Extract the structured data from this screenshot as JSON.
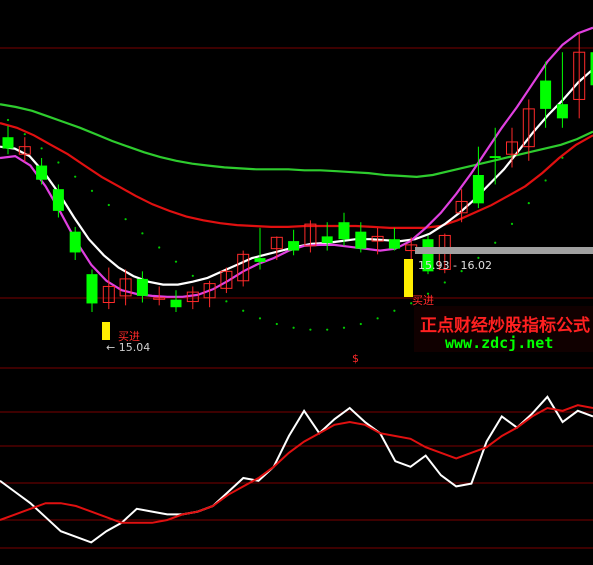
{
  "colors": {
    "background": "#000000",
    "grid": "#7a0000",
    "up_candle": "#ff2a2a",
    "down_candle_fill": "#00ff00",
    "hollow_up_fill": "#00e5ff",
    "signal_bar": "#ffee00",
    "ma_green": "#2ecc2e",
    "ma_red": "#e01010",
    "ma_white": "#ffffff",
    "ma_magenta": "#e040e0",
    "dots": "#00cc00",
    "price_line": "#a0a0a0",
    "watermark_cn": "#ff2020",
    "watermark_url": "#00ff00"
  },
  "labels": {
    "low_marker": "← 15.04",
    "buy_low": "买进",
    "buy_signal": "买进",
    "price_range": "15.93 - 16.02",
    "divider_mark": "$"
  },
  "watermark": {
    "cn": "正点财经炒股指标公式",
    "url": "www.zdcj.net"
  },
  "chart_data": [
    {
      "type": "candlestick",
      "title": "",
      "ylim": [
        14.6,
        18.2
      ],
      "x": [
        1,
        2,
        3,
        4,
        5,
        6,
        7,
        8,
        9,
        10,
        11,
        12,
        13,
        14,
        15,
        16,
        17,
        18,
        19,
        20,
        21,
        22,
        23,
        24,
        25,
        26,
        27,
        28,
        29,
        30,
        31,
        32,
        33,
        34,
        35,
        36,
        37,
        38,
        39,
        40,
        41,
        42,
        43,
        44,
        45,
        46,
        47,
        48,
        49
      ],
      "ohlc": [
        [
          16.8,
          16.92,
          16.62,
          16.68
        ],
        [
          16.62,
          16.8,
          16.54,
          16.7
        ],
        [
          16.5,
          16.58,
          16.3,
          16.35
        ],
        [
          16.25,
          16.3,
          15.95,
          16.02
        ],
        [
          15.8,
          15.85,
          15.5,
          15.58
        ],
        [
          15.35,
          15.4,
          14.95,
          15.04
        ],
        [
          15.05,
          15.42,
          14.98,
          15.22
        ],
        [
          15.12,
          15.4,
          15.02,
          15.3
        ],
        [
          15.3,
          15.38,
          15.05,
          15.12
        ],
        [
          15.1,
          15.22,
          15.02,
          15.1
        ],
        [
          15.08,
          15.18,
          14.95,
          15.0
        ],
        [
          15.06,
          15.22,
          14.98,
          15.16
        ],
        [
          15.1,
          15.28,
          15.0,
          15.25
        ],
        [
          15.2,
          15.42,
          15.15,
          15.38
        ],
        [
          15.28,
          15.6,
          15.22,
          15.56
        ],
        [
          15.52,
          15.84,
          15.4,
          15.48
        ],
        [
          15.62,
          15.75,
          15.5,
          15.74
        ],
        [
          15.7,
          15.82,
          15.55,
          15.6
        ],
        [
          15.65,
          15.92,
          15.58,
          15.88
        ],
        [
          15.75,
          15.9,
          15.6,
          15.68
        ],
        [
          15.9,
          16.0,
          15.65,
          15.72
        ],
        [
          15.8,
          15.9,
          15.58,
          15.62
        ],
        [
          15.7,
          15.84,
          15.56,
          15.75
        ],
        [
          15.72,
          15.84,
          15.6,
          15.62
        ],
        [
          15.6,
          15.74,
          15.5,
          15.66
        ],
        [
          15.72,
          15.76,
          15.35,
          15.38
        ],
        [
          15.4,
          15.78,
          15.36,
          15.76
        ],
        [
          16.0,
          16.25,
          15.9,
          16.12
        ],
        [
          16.4,
          16.7,
          16.05,
          16.1
        ],
        [
          16.6,
          16.9,
          16.3,
          16.58
        ],
        [
          16.62,
          16.9,
          16.48,
          16.75
        ],
        [
          16.7,
          17.2,
          16.55,
          17.1
        ],
        [
          17.4,
          17.6,
          16.9,
          17.1
        ],
        [
          17.15,
          17.7,
          16.9,
          17.0
        ],
        [
          17.2,
          17.9,
          17.0,
          17.7
        ],
        [
          17.7,
          18.1,
          17.2,
          17.35
        ],
        [
          17.3,
          17.6,
          17.2,
          17.45
        ],
        [
          17.4,
          17.8,
          17.3,
          17.55
        ],
        [
          17.6,
          17.95,
          17.4,
          17.8
        ],
        [
          17.75,
          18.0,
          17.55,
          17.85
        ]
      ],
      "series": [
        {
          "name": "",
          "values": [
            17.15,
            17.12,
            17.08,
            17.02,
            16.96,
            16.9,
            16.83,
            16.76,
            16.7,
            16.64,
            16.59,
            16.55,
            16.52,
            16.5,
            16.48,
            16.47,
            16.46,
            16.46,
            16.46,
            16.45,
            16.45,
            16.44,
            16.43,
            16.42,
            16.4,
            16.39,
            16.38,
            16.4,
            16.44,
            16.48,
            16.52,
            16.56,
            16.6,
            16.64,
            16.68,
            16.72,
            16.78,
            16.86
          ]
        },
        {
          "name": "",
          "values": [
            16.95,
            16.9,
            16.82,
            16.72,
            16.62,
            16.5,
            16.38,
            16.28,
            16.18,
            16.09,
            16.02,
            15.96,
            15.92,
            15.89,
            15.87,
            15.86,
            15.85,
            15.85,
            15.86,
            15.86,
            15.86,
            15.86,
            15.85,
            15.84,
            15.84,
            15.84,
            15.86,
            15.92,
            16.0,
            16.08,
            16.18,
            16.28,
            16.42,
            16.58,
            16.72,
            16.82
          ]
        },
        {
          "name": "",
          "values": [
            16.7,
            16.68,
            16.6,
            16.42,
            16.2,
            15.95,
            15.72,
            15.55,
            15.42,
            15.33,
            15.27,
            15.24,
            15.24,
            15.27,
            15.31,
            15.38,
            15.45,
            15.52,
            15.56,
            15.6,
            15.64,
            15.67,
            15.68,
            15.7,
            15.72,
            15.72,
            15.71,
            15.7,
            15.72,
            15.78,
            15.88,
            16.0,
            16.14,
            16.3,
            16.46,
            16.66,
            16.86,
            17.04,
            17.2,
            17.38,
            17.52
          ]
        },
        {
          "name": "",
          "values": [
            16.58,
            16.6,
            16.5,
            16.28,
            16.0,
            15.7,
            15.45,
            15.28,
            15.18,
            15.14,
            15.12,
            15.11,
            15.11,
            15.13,
            15.19,
            15.28,
            15.38,
            15.46,
            15.52,
            15.6,
            15.65,
            15.66,
            15.66,
            15.64,
            15.62,
            15.6,
            15.62,
            15.7,
            15.84,
            16.0,
            16.2,
            16.42,
            16.66,
            16.9,
            17.12,
            17.36,
            17.6,
            17.78,
            17.9,
            17.96
          ]
        },
        {
          "name": "",
          "values": [
            17.7,
            17.6,
            17.5,
            17.38,
            17.25,
            17.12,
            16.98,
            16.84,
            16.72,
            16.6,
            16.5,
            16.4,
            16.32,
            16.24,
            16.18,
            16.12,
            16.08,
            16.04,
            16.0,
            15.98,
            15.96,
            15.95,
            15.95,
            15.96,
            15.98,
            16.0,
            16.04,
            16.08,
            16.14,
            16.2,
            16.28,
            16.36,
            16.46,
            16.56,
            16.66,
            16.76,
            16.86,
            16.96,
            17.06,
            17.16
          ]
        }
      ]
    },
    {
      "type": "line",
      "title": "",
      "ylim": [
        -10,
        110
      ],
      "x": [
        1,
        2,
        3,
        4,
        5,
        6,
        7,
        8,
        9,
        10,
        11,
        12,
        13,
        14,
        15,
        16,
        17,
        18,
        19,
        20,
        21,
        22,
        23,
        24,
        25,
        26,
        27,
        28,
        29,
        30,
        31,
        32,
        33,
        34,
        35,
        36,
        37,
        38,
        39,
        40
      ],
      "series": [
        {
          "name": "",
          "values": [
            38,
            30,
            22,
            12,
            2,
            -2,
            -6,
            2,
            8,
            18,
            16,
            14,
            14,
            16,
            20,
            30,
            40,
            38,
            48,
            70,
            88,
            72,
            82,
            90,
            80,
            72,
            52,
            48,
            56,
            42,
            34,
            36,
            66,
            84,
            76,
            86,
            98,
            80,
            88,
            84
          ]
        },
        {
          "name": "",
          "values": [
            10,
            14,
            18,
            22,
            22,
            20,
            16,
            12,
            8,
            8,
            8,
            10,
            14,
            16,
            20,
            28,
            34,
            40,
            48,
            58,
            66,
            72,
            78,
            80,
            78,
            72,
            70,
            68,
            62,
            58,
            54,
            58,
            62,
            70,
            76,
            84,
            90,
            88,
            92,
            90
          ]
        }
      ]
    }
  ]
}
